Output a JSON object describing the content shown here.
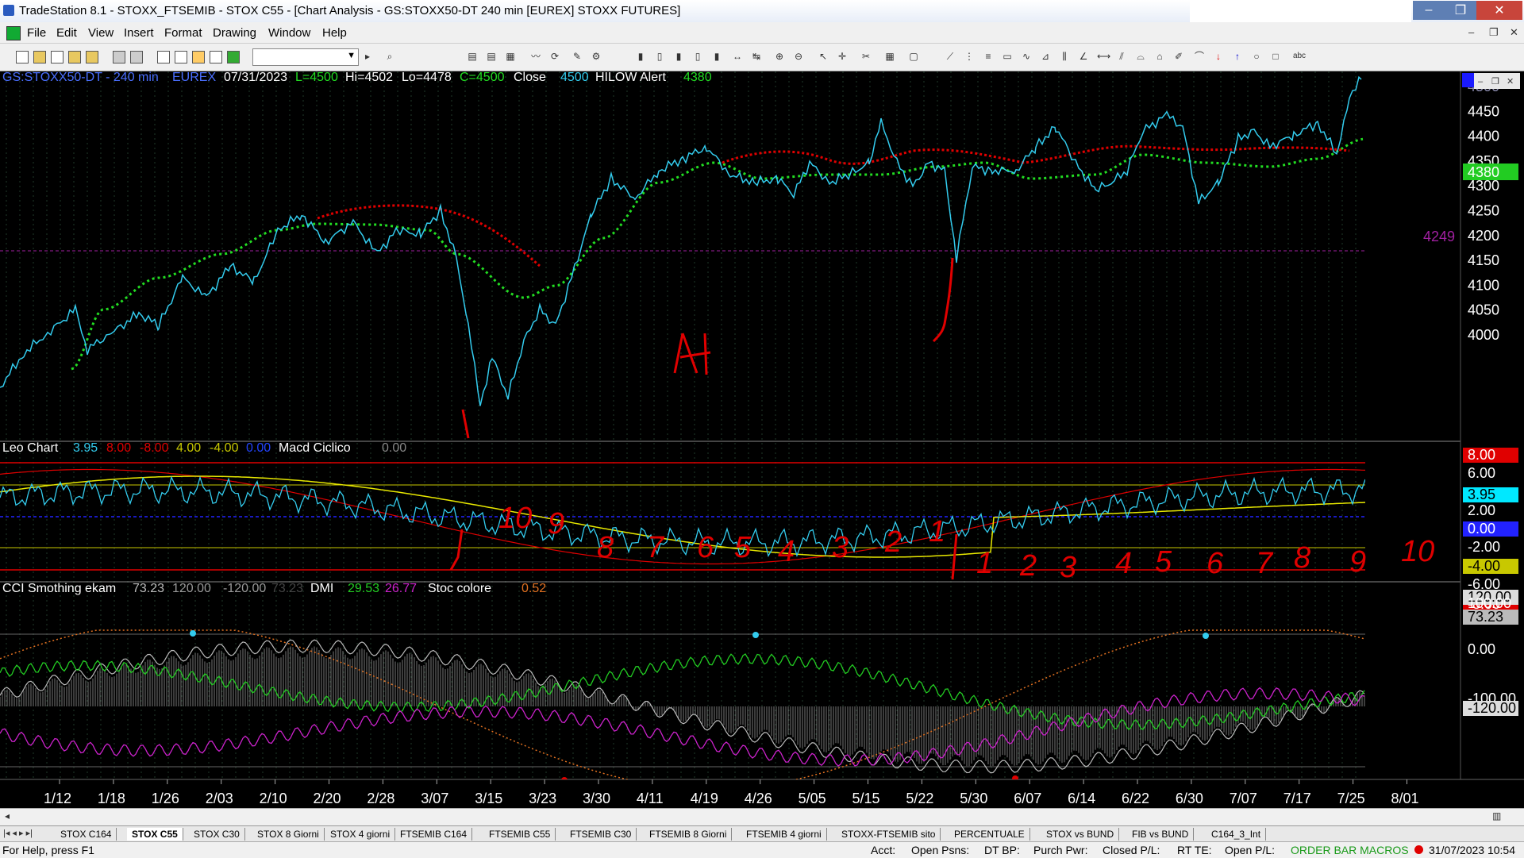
{
  "window": {
    "title": "TradeStation 8.1 - STOXX_FTSEMIB - STOX C55 - [Chart Analysis - GS:STOXX50-DT  240 min  [EUREX] STOXX FUTURES]",
    "minimize": "–",
    "maximize": "❐",
    "close": "✕"
  },
  "menu": [
    "File",
    "Edit",
    "View",
    "Insert",
    "Format",
    "Drawing",
    "Window",
    "Help"
  ],
  "chart": {
    "header": {
      "symbol": "GS:STOXX50-DT - 240 min",
      "exchange": "EUREX",
      "date": "07/31/2023",
      "last": "L=4500",
      "hi": "Hi=4502",
      "lo": "Lo=4478",
      "close": "C=4500",
      "close_label": "Close",
      "close_val": "4500",
      "alert_label": "HILOW Alert",
      "alert_val": "4380"
    },
    "price_axis": [
      "4500",
      "4450",
      "4400",
      "4350",
      "4300",
      "4250",
      "4200",
      "4150",
      "4100",
      "4050",
      "4000"
    ],
    "price_tag_green": "4380",
    "level_line_label": "4249",
    "annotation_text": "IA",
    "pane2": {
      "title": "Leo Chart",
      "v1": "3.95",
      "v2": "8.00",
      "v3": "-8.00",
      "v4": "4.00",
      "v5": "-4.00",
      "v6": "0.00",
      "name2": "Macd Ciclico",
      "v7": "0.00",
      "axis": [
        "8.00",
        "6.00",
        "3.95",
        "2.00",
        "0.00",
        "-2.00",
        "-4.00",
        "-6.00",
        "-8.00"
      ]
    },
    "pane3": {
      "title": "CCI Smothing ekam",
      "v1": "73.23",
      "v2": "120.00",
      "v3": "-120.00",
      "v4": "73.23",
      "dmi": "DMI",
      "v5": "29.53",
      "v6": "26.77",
      "stoc": "Stoc colore",
      "v7": "0.52",
      "axis": [
        "120.00",
        "100.00",
        "73.23",
        "0.00",
        "-100.00",
        "-120.00"
      ]
    },
    "dates": [
      "1/12",
      "1/18",
      "1/26",
      "2/03",
      "2/10",
      "2/20",
      "2/28",
      "3/07",
      "3/15",
      "3/23",
      "3/30",
      "4/11",
      "4/19",
      "4/26",
      "5/05",
      "5/15",
      "5/22",
      "5/30",
      "6/07",
      "6/14",
      "6/22",
      "6/30",
      "7/07",
      "7/17",
      "7/25",
      "8/01"
    ],
    "upper_counts": [
      "10",
      "9",
      "8",
      "7",
      "6",
      "5",
      "4",
      "3",
      "2",
      "1"
    ],
    "lower_counts": [
      "1",
      "2",
      "3",
      "4",
      "5",
      "6",
      "7",
      "8",
      "9",
      "10"
    ]
  },
  "tabs": [
    "STOX C164",
    "STOX C55",
    "STOX  C30",
    "STOX  8 Giorni",
    "STOX 4 giorni",
    "FTSEMIB C164",
    "FTSEMIB C55",
    "FTSEMIB C30",
    "FTSEMIB  8 Giorni",
    "FTSEMIB  4 giorni",
    "STOXX-FTSEMIB sito",
    "PERCENTUALE",
    "STOX vs BUND",
    "FIB vs BUND",
    "C164_3_Int"
  ],
  "status": {
    "help": "For Help, press F1",
    "acct": "Acct:",
    "open_psns": "Open Psns:",
    "dt_bp": "DT BP:",
    "purch_pwr": "Purch Pwr:",
    "closed_pl": "Closed P/L:",
    "rt_te": "RT TE:",
    "open_pl": "Open P/L:",
    "macros": "ORDER BAR  MACROS",
    "datetime": "31/07/2023 10:54"
  }
}
